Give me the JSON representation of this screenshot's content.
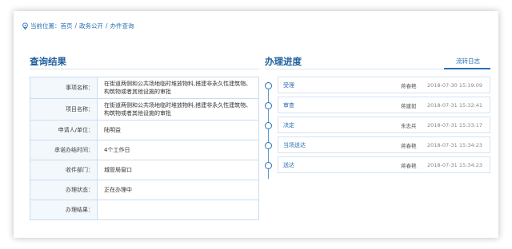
{
  "breadcrumb": {
    "prefix": "当前位置：",
    "items": [
      "首页",
      "政务公开",
      "办件查询"
    ],
    "separator": "/"
  },
  "result": {
    "title": "查询结果",
    "rows": [
      {
        "label": "事项名称：",
        "value": "在街道两侧和公共场地临时堆放物料,搭建非永久性建筑物、构筑物或者其他设施的审批"
      },
      {
        "label": "项目名称：",
        "value": "在街道两侧和公共场地临时堆放物料,搭建非永久性建筑物、构筑物或者其他设施的审批"
      },
      {
        "label": "申请人/单位：",
        "value": "陆明益"
      },
      {
        "label": "承诺办结时间：",
        "value": "4个工作日"
      },
      {
        "label": "收件部门：",
        "value": "城管局窗口"
      },
      {
        "label": "办理状态：",
        "value": "正在办理中"
      },
      {
        "label": "办理结果：",
        "value": ""
      }
    ]
  },
  "progress": {
    "title": "办理进度",
    "tab_label": "流转日志",
    "steps": [
      {
        "step": "受理",
        "person": "蒋春艳",
        "time": "2018-07-30 15:19:09"
      },
      {
        "step": "审查",
        "person": "蒋建如",
        "time": "2018-07-31 15:32:41"
      },
      {
        "step": "决定",
        "person": "朱忠兵",
        "time": "2018-07-31 15:33:17"
      },
      {
        "step": "当场送达",
        "person": "蒋春艳",
        "time": "2018-07-31 15:34:23"
      },
      {
        "step": "送达",
        "person": "蒋春艳",
        "time": "2018-07-31 15:34:23"
      }
    ]
  },
  "icons": {
    "location": "location-pin-icon",
    "timeline_node": "circle-node-icon"
  },
  "colors": {
    "accent": "#2a6fb5",
    "border": "#c9ddf0",
    "label_bg": "#f3f8fd"
  }
}
